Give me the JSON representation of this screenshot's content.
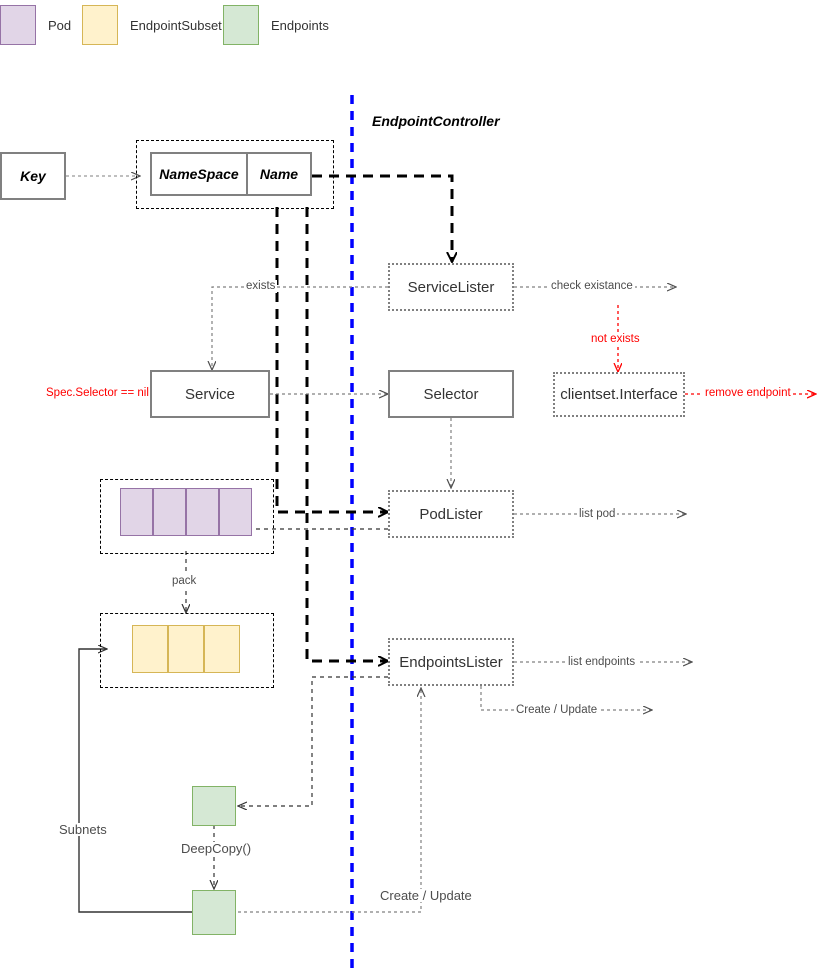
{
  "diagram": {
    "title": "EndpointController",
    "colors": {
      "pod_fill": "#e1d5e7",
      "pod_stroke": "#9673a6",
      "subset_fill": "#fff2cc",
      "subset_stroke": "#d6b656",
      "endpoints_fill": "#d5e8d4",
      "endpoints_stroke": "#82b366",
      "boundary": "#0000ff",
      "alert": "#ff0000",
      "node_stroke": "#808080"
    }
  },
  "legend": {
    "items": [
      {
        "label": "Pod",
        "swatch": "pod-swatch"
      },
      {
        "label": "EndpointSubset",
        "swatch": "endpointsubset-swatch"
      },
      {
        "label": "Endpoints",
        "swatch": "endpoints-swatch"
      }
    ]
  },
  "nodes": {
    "key": "Key",
    "namespace": "NameSpace",
    "name": "Name",
    "service_lister": "ServiceLister",
    "service": "Service",
    "selector": "Selector",
    "clientset_interface": "clientset.Interface",
    "pod_lister": "PodLister",
    "endpoints_lister": "EndpointsLister"
  },
  "edge_labels": {
    "exists": "exists",
    "check_existance": "check existance",
    "not_exists": "not exists",
    "remove_endpoint": "remove endpoint",
    "spec_selector_nil": "Spec.Selector == nil",
    "list_pod": "list pod",
    "pack": "pack",
    "list_endpoints": "list endpoints",
    "create_update_top": "Create / Update",
    "subnets": "Subnets",
    "deep_copy": "DeepCopy()",
    "create_update_bottom": "Create / Update"
  }
}
